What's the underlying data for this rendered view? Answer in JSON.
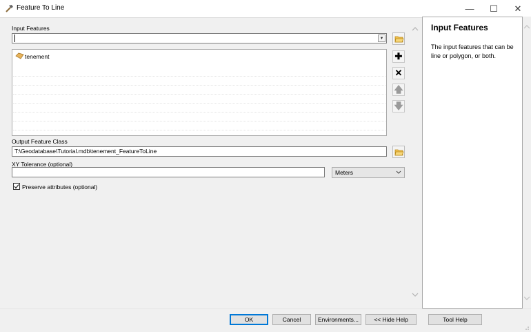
{
  "window": {
    "title": "Feature To Line",
    "minimize_glyph": "—",
    "maximize_glyph": "☐",
    "close_glyph": "✕",
    "app_icon": "hammer-icon"
  },
  "form": {
    "input_features": {
      "label": "Input Features",
      "value": "",
      "items": [
        {
          "label": "tenement",
          "icon": "polygon-layer-icon"
        }
      ]
    },
    "output_feature_class": {
      "label": "Output Feature Class",
      "value": "T:\\Geodatabase\\Tutorial.mdb\\tenement_FeatureToLine"
    },
    "xy_tolerance": {
      "label": "XY Tolerance (optional)",
      "value": "",
      "unit": "Meters"
    },
    "preserve_attributes": {
      "label": "Preserve attributes (optional)",
      "checked": true
    }
  },
  "help": {
    "title": "Input Features",
    "text": "The input features that can be line or polygon, or both."
  },
  "buttons": {
    "ok": "OK",
    "cancel": "Cancel",
    "environments": "Environments...",
    "hide_help": "<< Hide Help",
    "tool_help": "Tool Help"
  },
  "colors": {
    "accent": "#0078d7",
    "layer_icon": "#e8b45c"
  }
}
